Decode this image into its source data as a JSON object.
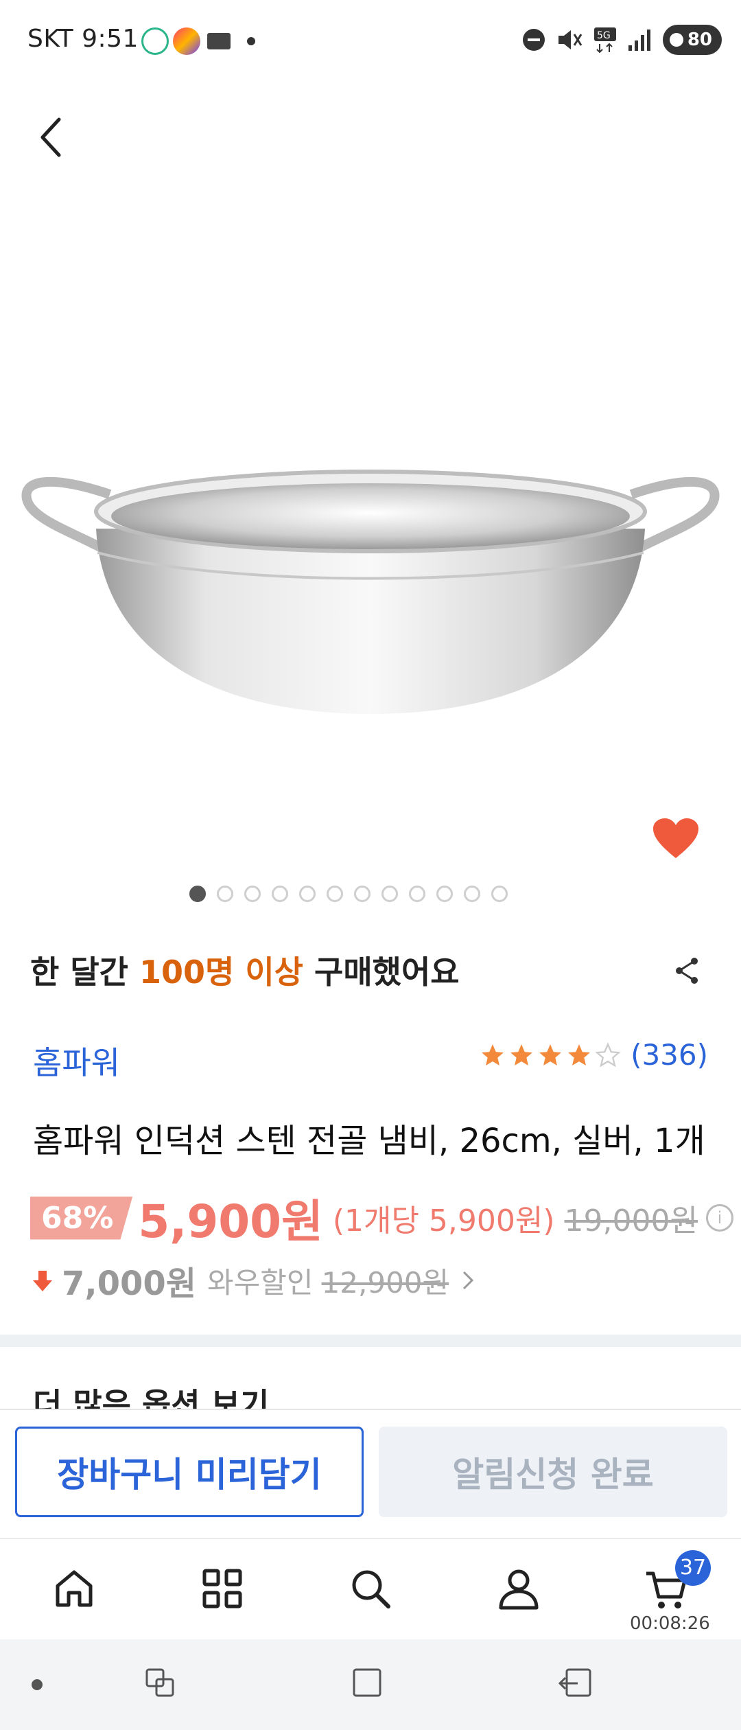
{
  "status_bar": {
    "carrier_time": "SKT 9:51",
    "app_icons": [
      "fork-icon",
      "ssg-icon",
      "n-plus-icon"
    ],
    "battery": "80",
    "icons": [
      "dnd-icon",
      "mute-icon",
      "5g-icon",
      "signal-icon",
      "battery-icon"
    ]
  },
  "header": {
    "back_icon": "chevron-left-icon"
  },
  "gallery": {
    "total": 12,
    "current": 1,
    "liked": true
  },
  "headline": {
    "pre": "한 달간 ",
    "highlight": "100명 이상",
    "post": " 구매했어요"
  },
  "product": {
    "brand": "홈파워",
    "rating": 4,
    "review_count": "(336)",
    "title": "홈파워 인덕션 스텐 전골 냄비, 26cm, 실버, 1개"
  },
  "price": {
    "discount": "68%",
    "sale": "5,900원",
    "unit": "(1개당 5,900원)",
    "original": "19,000원",
    "coupon_discount": "7,000원",
    "wow_label": "와우할인",
    "wow_price": "12,900원"
  },
  "sections": {
    "more_options": "더 많은 옵션 보기"
  },
  "actions": {
    "cart_button": "장바구니 미리담기",
    "notify_button": "알림신청 완료"
  },
  "bottom_nav": {
    "items": [
      "home-icon",
      "categories-icon",
      "search-icon",
      "account-icon",
      "cart-icon"
    ],
    "cart_count": "37",
    "timer": "00:08:26"
  },
  "colors": {
    "accent": "#2b64d8",
    "highlight": "#d9620c",
    "price": "#f07a6e",
    "heart": "#f05a3c",
    "star": "#f3893a"
  }
}
